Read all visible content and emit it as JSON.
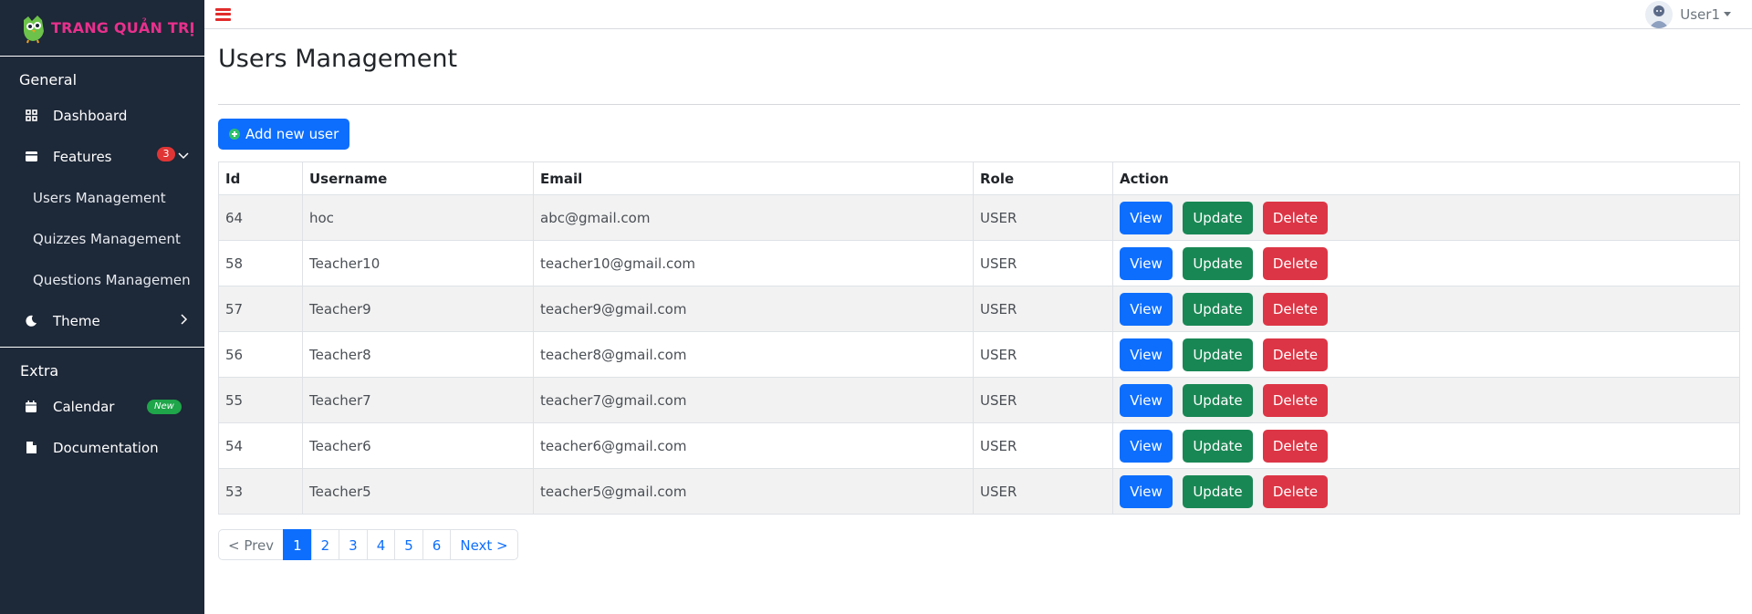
{
  "brand": {
    "title": "TRANG QUẢN TRỊ"
  },
  "sidebar": {
    "general_heading": "General",
    "extra_heading": "Extra",
    "dashboard": "Dashboard",
    "features": "Features",
    "features_badge": "3",
    "sub_items": [
      "Users Management",
      "Quizzes Management",
      "Questions Management"
    ],
    "theme": "Theme",
    "calendar": "Calendar",
    "calendar_badge": "New",
    "documentation": "Documentation"
  },
  "topbar": {
    "user_name": "User1"
  },
  "page": {
    "title": "Users Management",
    "add_button": "Add new user"
  },
  "table": {
    "headers": [
      "Id",
      "Username",
      "Email",
      "Role",
      "Action"
    ],
    "rows": [
      {
        "id": "64",
        "username": "hoc",
        "email": "abc@gmail.com",
        "role": "USER"
      },
      {
        "id": "58",
        "username": "Teacher10",
        "email": "teacher10@gmail.com",
        "role": "USER"
      },
      {
        "id": "57",
        "username": "Teacher9",
        "email": "teacher9@gmail.com",
        "role": "USER"
      },
      {
        "id": "56",
        "username": "Teacher8",
        "email": "teacher8@gmail.com",
        "role": "USER"
      },
      {
        "id": "55",
        "username": "Teacher7",
        "email": "teacher7@gmail.com",
        "role": "USER"
      },
      {
        "id": "54",
        "username": "Teacher6",
        "email": "teacher6@gmail.com",
        "role": "USER"
      },
      {
        "id": "53",
        "username": "Teacher5",
        "email": "teacher5@gmail.com",
        "role": "USER"
      }
    ],
    "actions": {
      "view": "View",
      "update": "Update",
      "delete": "Delete"
    }
  },
  "pagination": {
    "prev": "< Prev",
    "pages": [
      "1",
      "2",
      "3",
      "4",
      "5",
      "6"
    ],
    "active_page": "1",
    "next": "Next >"
  },
  "colors": {
    "sidebar_bg": "#1d2838",
    "brand_text": "#e8308c",
    "primary": "#0d6efd",
    "success": "#198754",
    "danger": "#dc3545"
  }
}
